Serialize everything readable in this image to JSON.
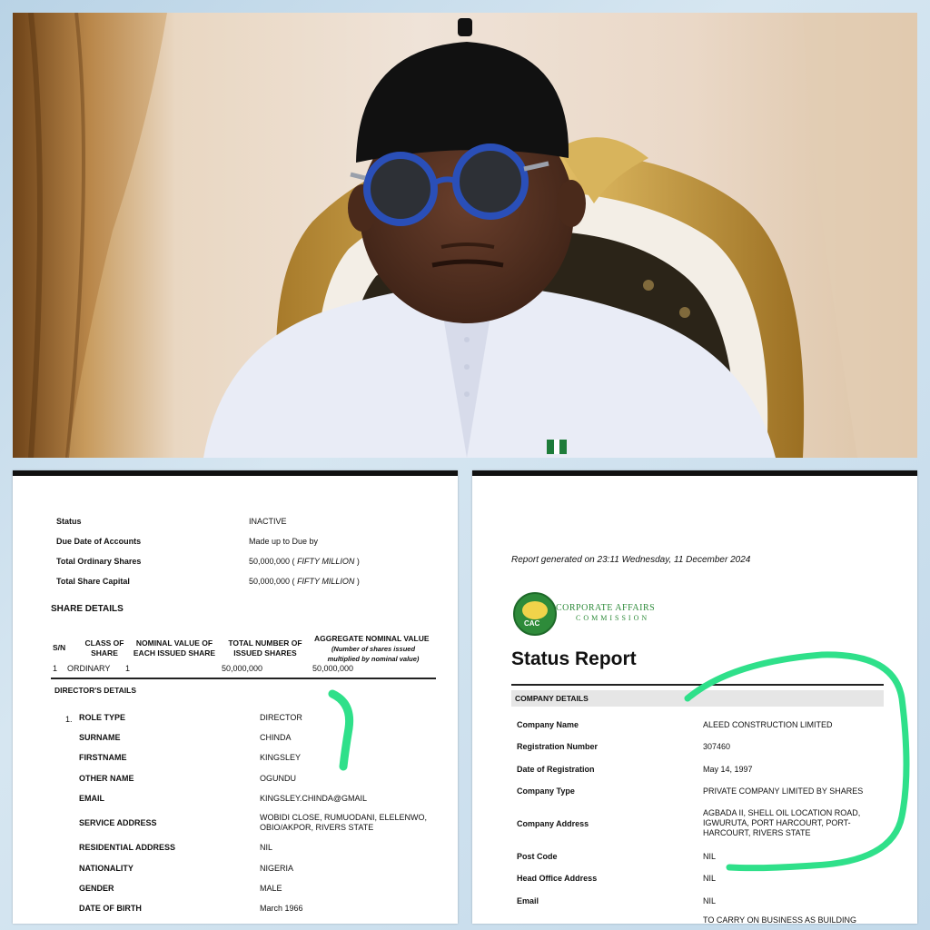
{
  "left_doc": {
    "summary": [
      {
        "label": "Status",
        "value": "INACTIVE"
      },
      {
        "label": "Due Date of Accounts",
        "value": "Made up to Due by"
      },
      {
        "label": "Total Ordinary Shares",
        "value": "50,000,000 (",
        "value_it": "FIFTY MILLION",
        "value_end": ")"
      },
      {
        "label": "Total Share Capital",
        "value": "50,000,000 (",
        "value_it": "FIFTY MILLION",
        "value_end": ")"
      }
    ],
    "share_title": "SHARE DETAILS",
    "share_headers": {
      "sn": "S/N",
      "class": "CLASS OF SHARE",
      "nominal": "NOMINAL VALUE OF EACH ISSUED SHARE",
      "total": "TOTAL NUMBER OF ISSUED SHARES",
      "aggregate": "AGGREGATE NOMINAL VALUE",
      "aggregate_note": "(Number of shares issued multiplied by nominal value)"
    },
    "share_row": {
      "sn": "1",
      "class": "ORDINARY",
      "nominal": "1",
      "total": "50,000,000",
      "aggregate": "50,000,000"
    },
    "directors_title": "DIRECTOR'S DETAILS",
    "director_index": "1.",
    "director_fields": [
      {
        "label": "ROLE TYPE",
        "value": "DIRECTOR"
      },
      {
        "label": "SURNAME",
        "value": "CHINDA"
      },
      {
        "label": "FIRSTNAME",
        "value": "KINGSLEY"
      },
      {
        "label": "OTHER NAME",
        "value": "OGUNDU"
      },
      {
        "label": "EMAIL",
        "value": "KINGSLEY.CHINDA@GMAIL"
      },
      {
        "label": "SERVICE ADDRESS",
        "value": "WOBIDI CLOSE, RUMUODANI, ELELENWO, OBIO/AKPOR, RIVERS STATE"
      },
      {
        "label": "RESIDENTIAL ADDRESS",
        "value": "NIL"
      },
      {
        "label": "NATIONALITY",
        "value": "NIGERIA"
      },
      {
        "label": "GENDER",
        "value": "MALE"
      },
      {
        "label": "DATE OF BIRTH",
        "value": "March 1966"
      }
    ]
  },
  "right_doc": {
    "generated": "Report generated on 23:11 Wednesday, 11 December 2024",
    "logo_line1": "CORPORATE AFFAIRS",
    "logo_line2": "COMMISSION",
    "logo_badge": "CAC",
    "title": "Status Report",
    "section": "COMPANY DETAILS",
    "fields": [
      {
        "label": "Company Name",
        "value": "ALEED CONSTRUCTION LIMITED"
      },
      {
        "label": "Registration Number",
        "value": "307460"
      },
      {
        "label": "Date of Registration",
        "value": "May 14, 1997"
      },
      {
        "label": "Company Type",
        "value": "PRIVATE COMPANY LIMITED BY SHARES"
      },
      {
        "label": "Company Address",
        "value": "AGBADA II, SHELL OIL LOCATION ROAD, IGWURUTA, PORT HARCOURT, PORT-HARCOURT, RIVERS STATE"
      },
      {
        "label": "Post Code",
        "value": "NIL"
      },
      {
        "label": "Head Office Address",
        "value": "NIL"
      },
      {
        "label": "Email",
        "value": "NIL"
      }
    ],
    "cutoff_text": "TO CARRY ON BUSINESS AS BUILDING"
  },
  "colors": {
    "highlight": "#2fe08a",
    "logo_green": "#2e8b3a",
    "section_bg": "#e6e6e6"
  }
}
